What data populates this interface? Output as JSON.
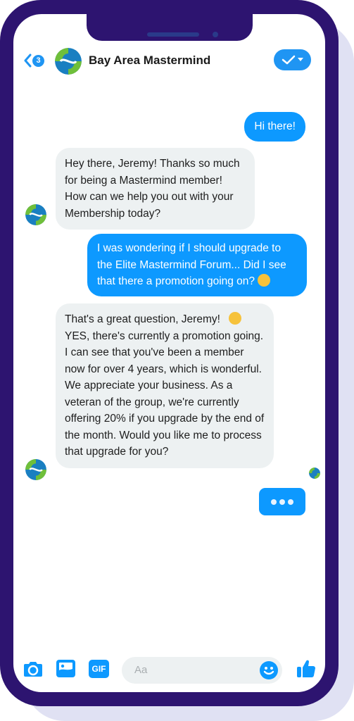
{
  "header": {
    "back_badge_count": "3",
    "title": "Bay Area Mastermind"
  },
  "messages": [
    {
      "from": "user",
      "text": "Hi there!"
    },
    {
      "from": "bot",
      "text": "Hey there, Jeremy! Thanks so much for being a Mastermind member! How can we help you out with your Membership today?"
    },
    {
      "from": "user",
      "text": "I was wondering if I should upgrade to the Elite Mastermind Forum... Did I see that there a promotion going on?",
      "emoji": "upside-down-face"
    },
    {
      "from": "bot",
      "text_before": "That's a great question, Jeremy!",
      "emoji": "smiling-face",
      "text_after": "YES, there's currently a promotion going. I can see that you've been a member now for over 4 years, which is wonderful. We appreciate your business. As a veteran of the group, we're currently offering 20% if you upgrade by the end of the month. Would you like me to process that upgrade for you?"
    }
  ],
  "composer": {
    "placeholder": "Aa",
    "gif_label": "GIF"
  },
  "colors": {
    "accent": "#0d99ff",
    "frame": "#2d1470",
    "bubble_in": "#edf1f2"
  }
}
